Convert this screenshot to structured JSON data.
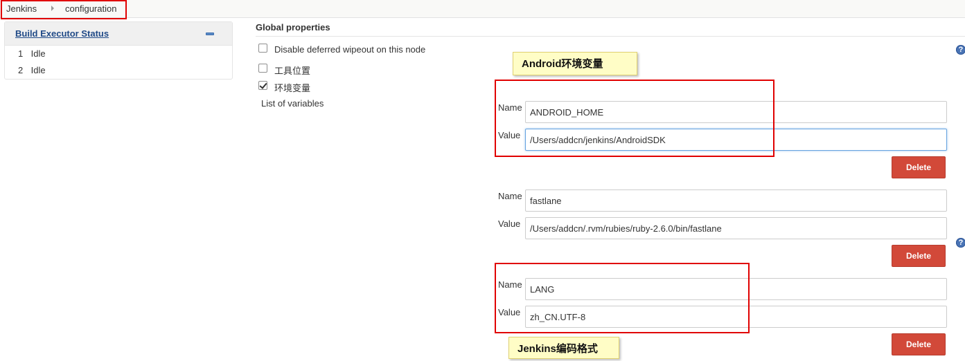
{
  "breadcrumb": {
    "items": [
      "Jenkins",
      "configuration"
    ]
  },
  "executor_panel": {
    "title": "Build Executor Status",
    "executors": [
      {
        "number": "1",
        "status": "Idle"
      },
      {
        "number": "2",
        "status": "Idle"
      }
    ]
  },
  "global_properties": {
    "title": "Global properties",
    "options": [
      {
        "label": "Disable deferred wipeout on this node",
        "checked": false
      },
      {
        "label": "工具位置",
        "checked": false
      },
      {
        "label": "环境变量",
        "checked": true
      }
    ],
    "list_label": "List of variables",
    "name_label": "Name",
    "value_label": "Value",
    "delete_label": "Delete",
    "variables": [
      {
        "name": "ANDROID_HOME",
        "value": "/Users/addcn/jenkins/AndroidSDK"
      },
      {
        "name": "fastlane",
        "value": "/Users/addcn/.rvm/rubies/ruby-2.6.0/bin/fastlane"
      },
      {
        "name": "LANG",
        "value": "zh_CN.UTF-8"
      }
    ]
  },
  "annotations": {
    "android_note": "Android环境变量",
    "encoding_note": "Jenkins编码格式"
  },
  "help_icon_glyph": "?",
  "colors": {
    "delete_button": "#d24939",
    "annotation_box": "#e00000",
    "callout_bg": "#fffdc6",
    "link": "#204a87",
    "help_icon": "#4a74b5"
  }
}
